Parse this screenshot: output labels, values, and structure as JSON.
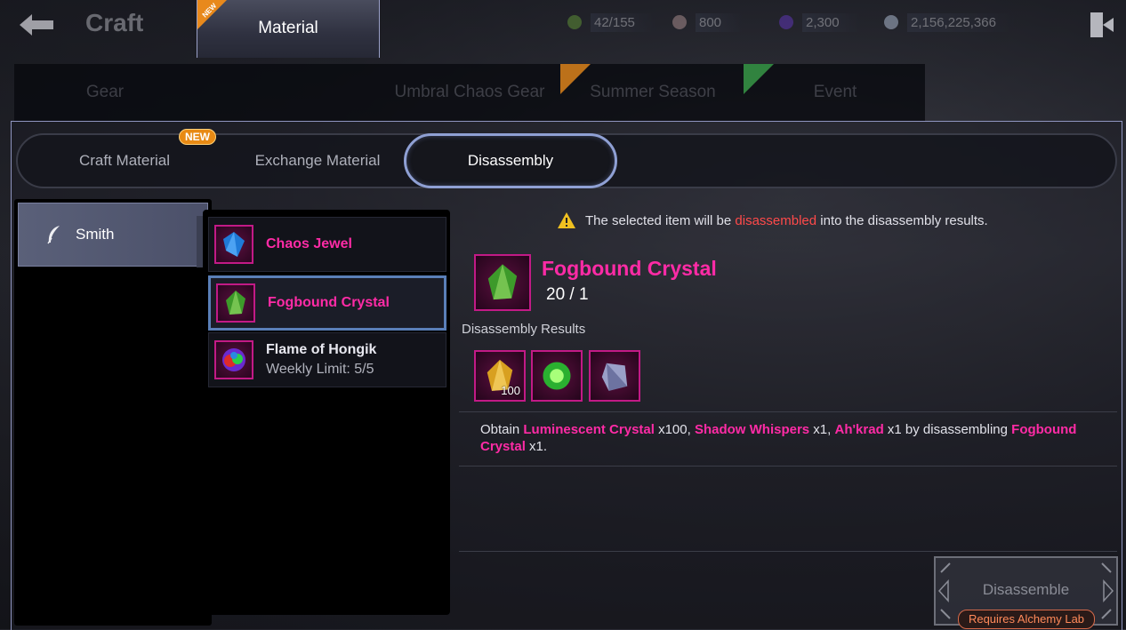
{
  "header": {
    "title": "Craft",
    "resources": [
      {
        "icon": "stamina-icon",
        "value": "42/155",
        "color": "#6aa63a"
      },
      {
        "icon": "silver-icon",
        "value": "800",
        "color": "#c0a0a0"
      },
      {
        "icon": "gem-icon",
        "value": "2,300",
        "color": "#6a3ad0"
      },
      {
        "icon": "crystal-icon",
        "value": "2,156,225,366",
        "color": "#c8d8f0"
      }
    ]
  },
  "main_tabs": [
    {
      "label": "Gear"
    },
    {
      "label": "Material",
      "badge": "NEW"
    },
    {
      "label": "Umbral Chaos Gear"
    },
    {
      "label": "Summer Season"
    },
    {
      "label": "Event"
    }
  ],
  "sub_tabs": [
    {
      "label": "Craft Material",
      "badge": "NEW"
    },
    {
      "label": "Exchange Material"
    },
    {
      "label": "Disassembly"
    }
  ],
  "category": {
    "label": "Smith",
    "icon": "feather-icon"
  },
  "items": [
    {
      "name": "Chaos Jewel",
      "icon": "chaos-jewel-icon"
    },
    {
      "name": "Fogbound Crystal",
      "icon": "fogbound-crystal-icon"
    },
    {
      "name": "Flame of Hongik",
      "sub": "Weekly Limit: 5/5",
      "icon": "flame-of-hongik-icon"
    }
  ],
  "detail": {
    "warning_pre": "The selected item will be ",
    "warning_red": "disassembled",
    "warning_post": " into the disassembly results.",
    "name": "Fogbound Crystal",
    "count": "20 / 1",
    "results_label": "Disassembly Results",
    "results": [
      {
        "icon": "luminescent-crystal-icon",
        "qty": "100"
      },
      {
        "icon": "shadow-whispers-icon",
        "qty": ""
      },
      {
        "icon": "ahkrad-icon",
        "qty": ""
      }
    ],
    "desc": {
      "p1": "Obtain ",
      "i1": "Luminescent Crystal",
      "p2": " x100, ",
      "i2": "Shadow Whispers",
      "p3": " x1, ",
      "i3": "Ah'krad",
      "p4": " x1 by disassembling ",
      "i4": "Fogbound Crystal",
      "p5": " x1."
    }
  },
  "action": {
    "button": "Disassemble",
    "requirement": "Requires Alchemy Lab"
  }
}
